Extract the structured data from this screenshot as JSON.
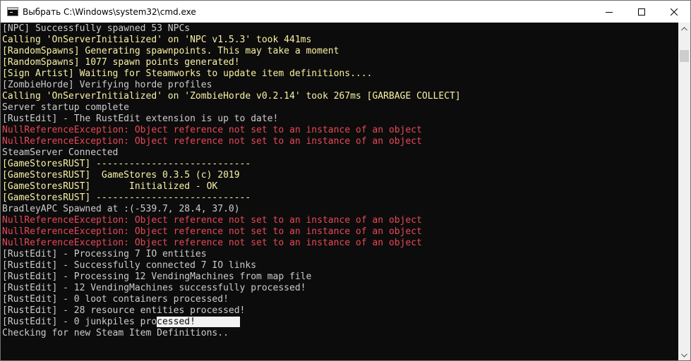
{
  "window": {
    "title": "Выбрать C:\\Windows\\system32\\cmd.exe"
  },
  "console": {
    "lines": [
      {
        "segments": [
          {
            "text": "[NPC] Successfully spawned 53 NPCs",
            "color": "gray"
          }
        ]
      },
      {
        "segments": [
          {
            "text": "Calling 'OnServerInitialized' on 'NPC v1.5.3' took 441ms",
            "color": "yellow"
          }
        ]
      },
      {
        "segments": [
          {
            "text": "[RandomSpawns] Generating spawnpoints. This may take a moment",
            "color": "yellow"
          }
        ]
      },
      {
        "segments": [
          {
            "text": "[RandomSpawns] 1077 spawn points generated!",
            "color": "yellow"
          }
        ]
      },
      {
        "segments": [
          {
            "text": "[Sign Artist] Waiting for Steamworks to update item definitions....",
            "color": "yellow"
          }
        ]
      },
      {
        "segments": [
          {
            "text": "[ZombieHorde] Verifying horde profiles",
            "color": "gray"
          }
        ]
      },
      {
        "segments": [
          {
            "text": "Calling 'OnServerInitialized' on 'ZombieHorde v0.2.14' took 267ms [GARBAGE COLLECT]",
            "color": "yellow"
          }
        ]
      },
      {
        "segments": [
          {
            "text": "Server startup complete",
            "color": "gray"
          }
        ]
      },
      {
        "segments": [
          {
            "text": "[RustEdit] - The RustEdit extension is up to date!",
            "color": "gray"
          }
        ]
      },
      {
        "segments": [
          {
            "text": "NullReferenceException: Object reference not set to an instance of an object",
            "color": "red"
          }
        ]
      },
      {
        "segments": [
          {
            "text": "NullReferenceException: Object reference not set to an instance of an object",
            "color": "red"
          }
        ]
      },
      {
        "segments": [
          {
            "text": "SteamServer Connected",
            "color": "gray"
          }
        ]
      },
      {
        "segments": [
          {
            "text": "[GameStoresRUST] ----------------------------",
            "color": "yellow"
          }
        ]
      },
      {
        "segments": [
          {
            "text": "[GameStoresRUST]  GameStores 0.3.5 (c) 2019",
            "color": "yellow"
          }
        ]
      },
      {
        "segments": [
          {
            "text": "[GameStoresRUST]       Initialized - OK",
            "color": "yellow"
          }
        ]
      },
      {
        "segments": [
          {
            "text": "[GameStoresRUST] ----------------------------",
            "color": "yellow"
          }
        ]
      },
      {
        "segments": [
          {
            "text": "BradleyAPC Spawned at :(-539.7, 28.4, 37.0)",
            "color": "gray"
          }
        ]
      },
      {
        "segments": [
          {
            "text": "NullReferenceException: Object reference not set to an instance of an object",
            "color": "red"
          }
        ]
      },
      {
        "segments": [
          {
            "text": "NullReferenceException: Object reference not set to an instance of an object",
            "color": "red"
          }
        ]
      },
      {
        "segments": [
          {
            "text": "NullReferenceException: Object reference not set to an instance of an object",
            "color": "red"
          }
        ]
      },
      {
        "segments": [
          {
            "text": "[RustEdit] - Processing 7 IO entities",
            "color": "gray"
          }
        ]
      },
      {
        "segments": [
          {
            "text": "[RustEdit] - Successfully connected 7 IO links",
            "color": "gray"
          }
        ]
      },
      {
        "segments": [
          {
            "text": "[RustEdit] - Processing 12 VendingMachines from map file",
            "color": "gray"
          }
        ]
      },
      {
        "segments": [
          {
            "text": "[RustEdit] - 12 VendingMachines successfully processed!",
            "color": "gray"
          }
        ]
      },
      {
        "segments": [
          {
            "text": "[RustEdit] - 0 loot containers processed!",
            "color": "gray"
          }
        ]
      },
      {
        "segments": [
          {
            "text": "[RustEdit] - 28 resource entities processed!",
            "color": "gray"
          }
        ]
      },
      {
        "segments": [
          {
            "text": "[RustEdit] - 0 junkpiles pro",
            "color": "gray"
          },
          {
            "text": "cessed!        ",
            "color": "selected"
          }
        ]
      },
      {
        "segments": [
          {
            "text": "Checking for new Steam Item Definitions..",
            "color": "gray"
          }
        ]
      }
    ]
  },
  "colors": {
    "gray": "#cccccc",
    "yellow": "#f9f1a5",
    "red": "#e74856",
    "background": "#0c0c0c"
  },
  "icons": {
    "app": "console-app-icon",
    "minimize": "minimize-icon",
    "maximize": "maximize-icon",
    "close": "close-icon",
    "scroll_up": "chevron-up-icon",
    "scroll_down": "chevron-down-icon"
  }
}
